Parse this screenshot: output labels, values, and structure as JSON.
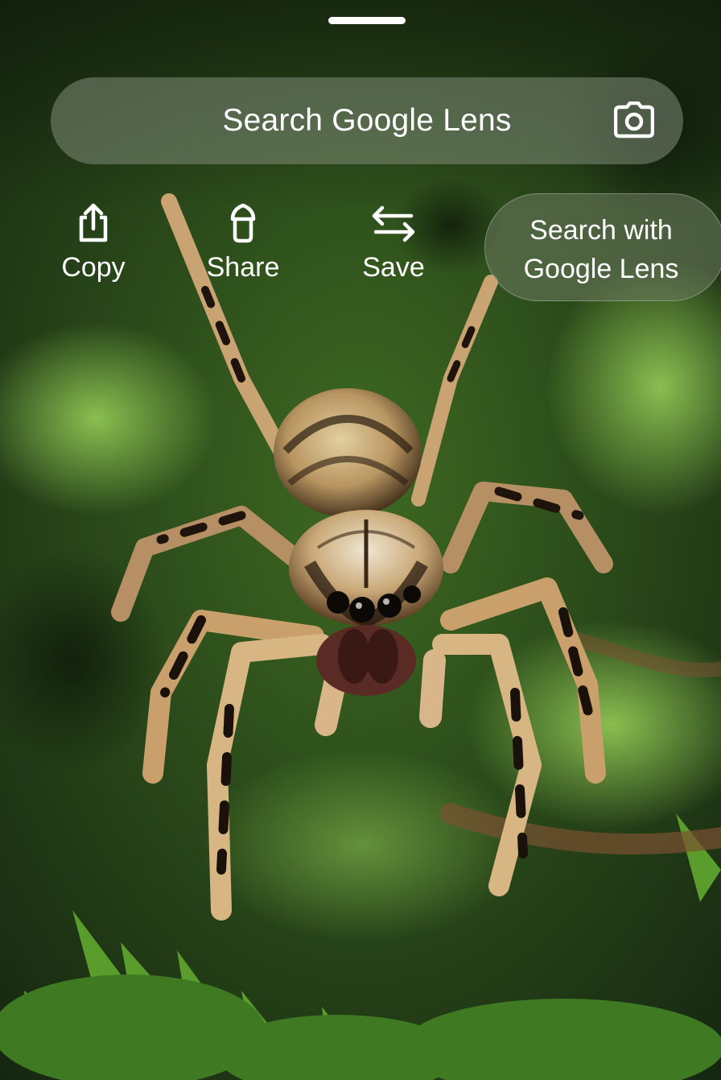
{
  "overlay": {
    "search_bar": {
      "label": "Search Google Lens",
      "icon": "camera-icon"
    },
    "actions": [
      {
        "label": "Copy",
        "icon": "upload-share-icon"
      },
      {
        "label": "Share",
        "icon": "upload-share-icon"
      },
      {
        "label": "Save",
        "icon": "swap-arrows-icon"
      }
    ],
    "lens_button": {
      "line1": "Search with",
      "line2": "Google Lens"
    }
  },
  "colors": {
    "text": "#ffffff",
    "foliage": "#3f7a22",
    "spider_body": "#c9a877"
  }
}
